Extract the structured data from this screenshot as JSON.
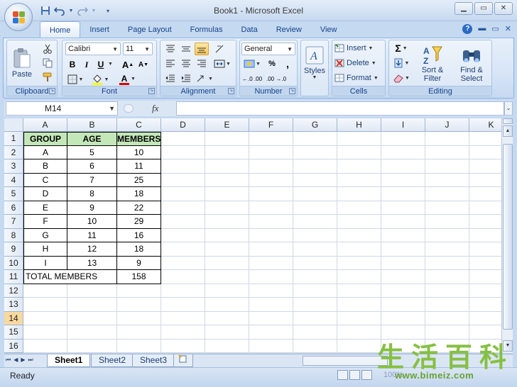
{
  "window": {
    "title": "Book1 - Microsoft Excel",
    "minimize": "▁",
    "restore": "▭",
    "close": "✕"
  },
  "tabs": [
    "Home",
    "Insert",
    "Page Layout",
    "Formulas",
    "Data",
    "Review",
    "View"
  ],
  "ribbon": {
    "clipboard": {
      "label": "Clipboard",
      "paste": "Paste"
    },
    "font": {
      "label": "Font",
      "name": "Calibri",
      "size": "11",
      "bold": "B",
      "italic": "I",
      "underline": "U",
      "grow": "A",
      "shrink": "A",
      "font_color_letter": "A"
    },
    "alignment": {
      "label": "Alignment"
    },
    "number": {
      "label": "Number",
      "format": "General",
      "percent": "%",
      "comma": ",",
      "inc_decimal": "←.0 .00",
      "dec_decimal": ".00 →.0"
    },
    "styles": {
      "label": "Styles"
    },
    "cells": {
      "label": "Cells",
      "insert": "Insert",
      "delete": "Delete",
      "format": "Format"
    },
    "editing": {
      "label": "Editing",
      "sigma": "Σ",
      "sort_filter": "Sort & Filter",
      "find_select": "Find & Select"
    }
  },
  "formula_bar": {
    "name_box": "M14",
    "fx": "fx",
    "value": ""
  },
  "columns": [
    "A",
    "B",
    "C",
    "D",
    "E",
    "F",
    "G",
    "H",
    "I",
    "J",
    "K"
  ],
  "rows": [
    "1",
    "2",
    "3",
    "4",
    "5",
    "6",
    "7",
    "8",
    "9",
    "10",
    "11",
    "12",
    "13",
    "14",
    "15",
    "16"
  ],
  "selected_row": "14",
  "table": {
    "headers": [
      "GROUP",
      "AGE",
      "MEMBERS"
    ],
    "data": [
      [
        "A",
        "5",
        "10"
      ],
      [
        "B",
        "6",
        "11"
      ],
      [
        "C",
        "7",
        "25"
      ],
      [
        "D",
        "8",
        "18"
      ],
      [
        "E",
        "9",
        "22"
      ],
      [
        "F",
        "10",
        "29"
      ],
      [
        "G",
        "11",
        "16"
      ],
      [
        "H",
        "12",
        "18"
      ],
      [
        "I",
        "13",
        "9"
      ]
    ],
    "total_label": "TOTAL MEMBERS",
    "total_value": "158"
  },
  "sheets": [
    "Sheet1",
    "Sheet2",
    "Sheet3"
  ],
  "active_sheet": "Sheet1",
  "status": "Ready",
  "zoom": "100%",
  "watermark": {
    "chars": [
      "生",
      "活",
      "百",
      "科"
    ],
    "url": "www.bimeiz.com"
  },
  "colors": {
    "header_fill": "#c4e7b9",
    "selected_row_header": "#f9d99f",
    "ribbon_text": "#15428b"
  }
}
